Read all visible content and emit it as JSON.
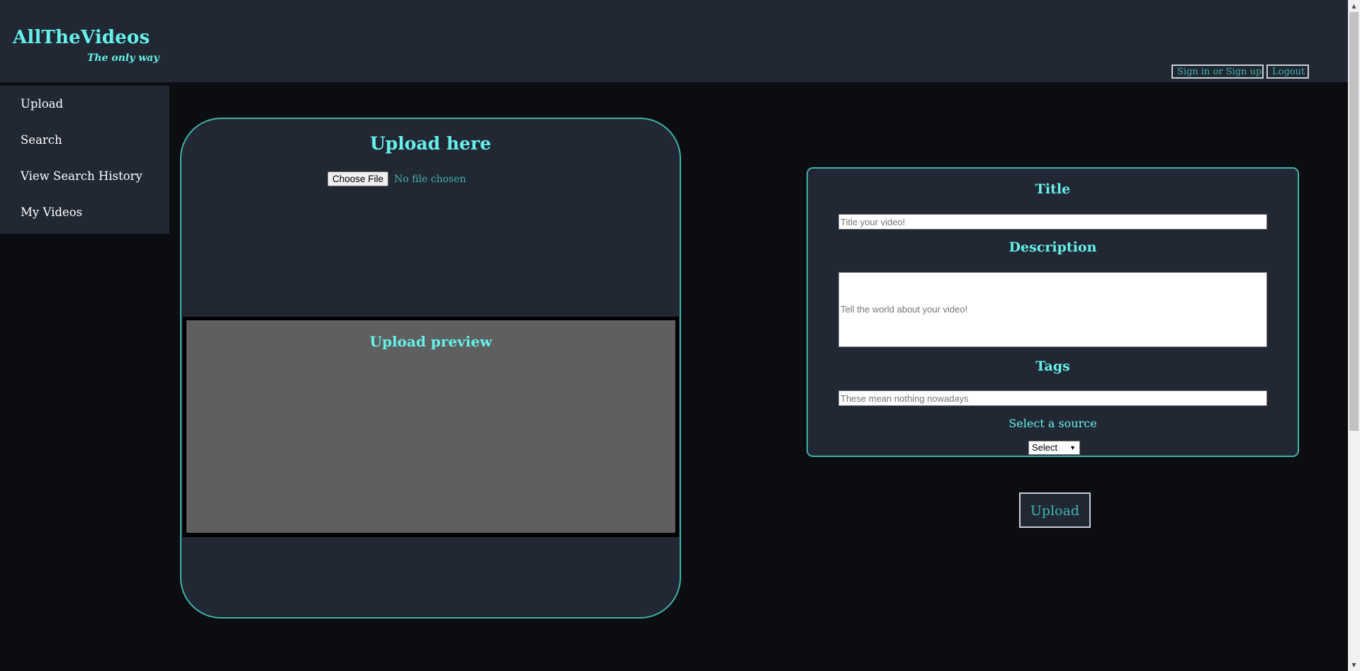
{
  "header": {
    "brand": "AllTheVideos",
    "tagline": "The only way",
    "signin_label": "Sign in or Sign up",
    "logout_label": "Logout"
  },
  "sidebar": {
    "items": [
      {
        "label": "Upload"
      },
      {
        "label": "Search"
      },
      {
        "label": "View Search History"
      },
      {
        "label": "My Videos"
      }
    ]
  },
  "upload_panel": {
    "title": "Upload here",
    "choose_file_label": "Choose File",
    "no_file_text": "No file chosen",
    "preview_title": "Upload preview"
  },
  "details": {
    "title_label": "Title",
    "title_placeholder": "Title your video!",
    "description_label": "Description",
    "description_placeholder": "Tell the world about your video!",
    "tags_label": "Tags",
    "tags_placeholder": "These mean nothing nowadays",
    "source_label": "Select a source",
    "source_selected": "Select"
  },
  "submit": {
    "upload_label": "Upload"
  },
  "colors": {
    "background": "#0b0d11",
    "panel": "#212834",
    "accent": "#66f0ea",
    "accent_dim": "#3fb3a8",
    "preview": "#5f5f5f"
  },
  "icons": {
    "select_arrow": "triangle-down-icon",
    "scroll_up": "scroll-up-arrow-icon",
    "scroll_down": "scroll-down-arrow-icon"
  }
}
